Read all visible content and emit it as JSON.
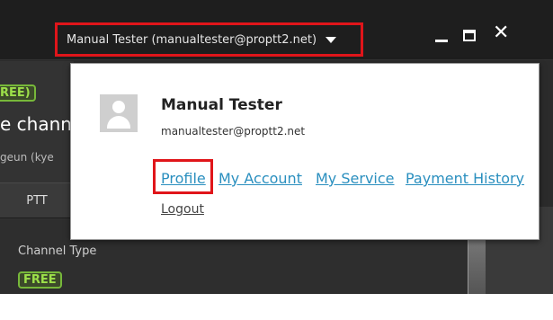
{
  "titlebar": {
    "user_label": "Manual Tester (manualtester@proptt2.net)"
  },
  "window_controls": {
    "minimize": "minimize-icon",
    "maximize": "maximize-icon",
    "close": "close-icon"
  },
  "left_panel": {
    "badge": "REE)",
    "channel_name": "e chann",
    "channel_sub": "geun (kye",
    "tab": "PTT"
  },
  "content": {
    "channel_type_label": "Channel Type",
    "badge": "FREE"
  },
  "popup": {
    "name": "Manual Tester",
    "email": "manualtester@proptt2.net",
    "links": [
      "Profile",
      "My Account",
      "My Service",
      "Payment History"
    ],
    "logout": "Logout"
  },
  "colors": {
    "highlight": "#e0151a",
    "link": "#2a8fbf",
    "badge_green": "#9de04a"
  }
}
